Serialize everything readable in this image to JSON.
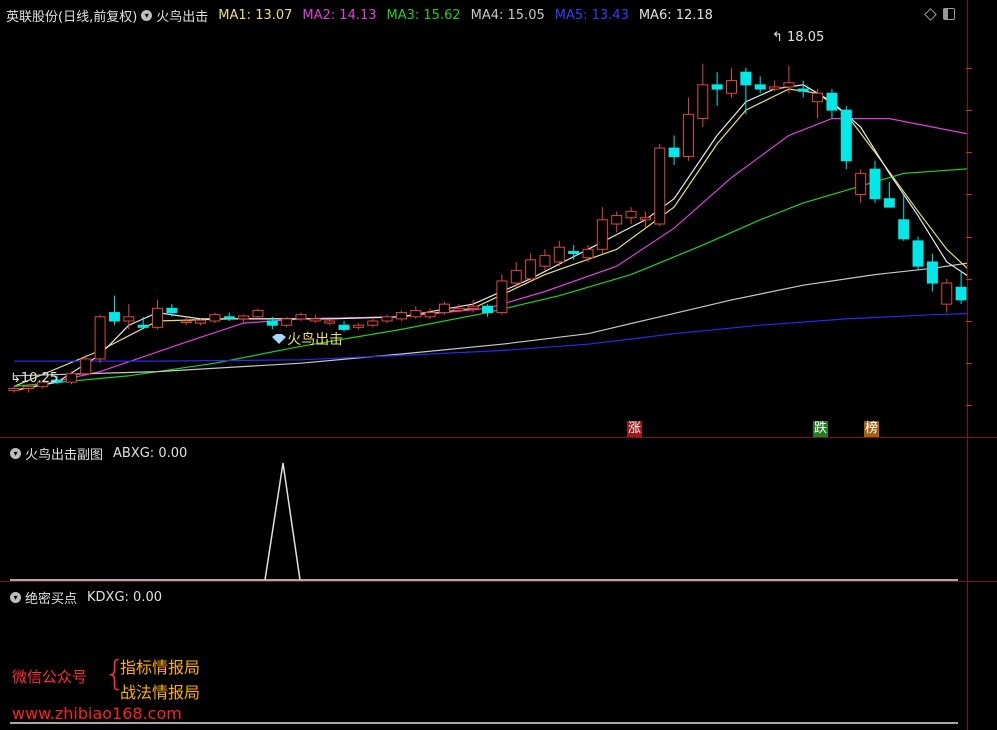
{
  "main": {
    "title": "英联股份(日线,前复权)",
    "indicator": "火鸟出击",
    "ma": [
      {
        "label": "MA1: 13.07",
        "color": "#e8e070"
      },
      {
        "label": "MA2: 14.13",
        "color": "#e040e0"
      },
      {
        "label": "MA3: 15.62",
        "color": "#20d020"
      },
      {
        "label": "MA4: 15.05",
        "color": "#c8c8c8"
      },
      {
        "label": "MA5: 13.43",
        "color": "#3a3aff"
      },
      {
        "label": "MA6: 12.18",
        "color": "#e0e0e0"
      }
    ],
    "high_label": "18.05",
    "low_label": "10.25",
    "signal_label": "火鸟出击",
    "markers": {
      "zhang": "涨",
      "die": "跌",
      "bang": "榜"
    }
  },
  "sub1": {
    "title": "火鸟出击副图",
    "value": "ABXG: 0.00"
  },
  "sub2": {
    "title": "绝密买点",
    "value": "KDXG: 0.00"
  },
  "watermark": {
    "wechat": "微信公众号",
    "line1": "指标情报局",
    "line2": "战法情报局",
    "url": "www.zhibiao168.com"
  },
  "colors": {
    "up": "#e0483a",
    "down": "#00e8e8",
    "grid": "#7a1818"
  },
  "chart_data": {
    "type": "candlestick",
    "candles": [
      [
        10.35,
        10.45,
        10.3,
        10.4
      ],
      [
        10.4,
        10.5,
        10.3,
        10.45
      ],
      [
        10.45,
        10.6,
        10.4,
        10.55
      ],
      [
        10.6,
        10.7,
        10.5,
        10.55
      ],
      [
        10.55,
        10.8,
        10.5,
        10.75
      ],
      [
        10.75,
        11.2,
        10.7,
        11.1
      ],
      [
        11.1,
        12.15,
        11.0,
        12.1
      ],
      [
        12.2,
        12.6,
        11.9,
        12.0
      ],
      [
        12.0,
        12.4,
        11.8,
        12.1
      ],
      [
        11.9,
        12.1,
        11.8,
        11.85
      ],
      [
        11.85,
        12.5,
        11.8,
        12.3
      ],
      [
        12.3,
        12.4,
        12.1,
        12.2
      ],
      [
        12.0,
        12.1,
        11.9,
        12.0
      ],
      [
        11.95,
        12.05,
        11.9,
        12.02
      ],
      [
        12.0,
        12.2,
        11.95,
        12.15
      ],
      [
        12.1,
        12.2,
        12.0,
        12.08
      ],
      [
        12.05,
        12.15,
        11.95,
        12.12
      ],
      [
        12.1,
        12.3,
        12.05,
        12.25
      ],
      [
        12.0,
        12.1,
        11.8,
        11.9
      ],
      [
        11.9,
        12.1,
        11.85,
        12.05
      ],
      [
        12.05,
        12.2,
        12.0,
        12.15
      ],
      [
        12.0,
        12.15,
        11.95,
        12.05
      ],
      [
        11.95,
        12.05,
        11.9,
        12.0
      ],
      [
        11.9,
        12.0,
        11.75,
        11.8
      ],
      [
        11.85,
        11.95,
        11.8,
        11.9
      ],
      [
        11.9,
        12.05,
        11.85,
        12.0
      ],
      [
        12.0,
        12.15,
        11.95,
        12.1
      ],
      [
        12.05,
        12.25,
        12.0,
        12.2
      ],
      [
        12.1,
        12.35,
        12.05,
        12.25
      ],
      [
        12.1,
        12.3,
        12.05,
        12.2
      ],
      [
        12.2,
        12.45,
        12.15,
        12.4
      ],
      [
        12.25,
        12.4,
        12.2,
        12.3
      ],
      [
        12.3,
        12.5,
        12.2,
        12.35
      ],
      [
        12.35,
        12.4,
        12.1,
        12.2
      ],
      [
        12.2,
        13.1,
        12.15,
        12.95
      ],
      [
        12.9,
        13.4,
        12.8,
        13.2
      ],
      [
        13.0,
        13.6,
        12.95,
        13.45
      ],
      [
        13.3,
        13.7,
        13.2,
        13.55
      ],
      [
        13.4,
        13.9,
        13.3,
        13.75
      ],
      [
        13.65,
        13.8,
        13.45,
        13.6
      ],
      [
        13.5,
        13.8,
        13.4,
        13.7
      ],
      [
        13.7,
        14.7,
        13.6,
        14.4
      ],
      [
        14.3,
        14.6,
        14.1,
        14.5
      ],
      [
        14.45,
        14.7,
        14.3,
        14.6
      ],
      [
        14.4,
        14.6,
        14.2,
        14.45
      ],
      [
        14.3,
        16.2,
        14.25,
        16.1
      ],
      [
        16.1,
        16.4,
        15.7,
        15.9
      ],
      [
        15.9,
        17.3,
        15.8,
        16.9
      ],
      [
        16.8,
        18.1,
        16.6,
        17.6
      ],
      [
        17.6,
        17.9,
        17.1,
        17.5
      ],
      [
        17.4,
        18.0,
        17.3,
        17.7
      ],
      [
        17.9,
        18.0,
        16.9,
        17.6
      ],
      [
        17.6,
        17.8,
        17.4,
        17.5
      ],
      [
        17.5,
        17.7,
        17.45,
        17.55
      ],
      [
        17.55,
        18.05,
        17.4,
        17.65
      ],
      [
        17.5,
        17.7,
        17.3,
        17.45
      ],
      [
        17.2,
        17.5,
        16.8,
        17.4
      ],
      [
        17.4,
        17.5,
        16.8,
        17.0
      ],
      [
        17.0,
        17.1,
        15.6,
        15.8
      ],
      [
        15.0,
        15.6,
        14.8,
        15.5
      ],
      [
        15.6,
        15.8,
        14.8,
        14.9
      ],
      [
        14.9,
        15.3,
        14.7,
        14.7
      ],
      [
        14.4,
        15.0,
        13.9,
        13.95
      ],
      [
        13.9,
        14.0,
        13.2,
        13.3
      ],
      [
        13.4,
        13.6,
        12.7,
        12.9
      ],
      [
        12.4,
        13.0,
        12.2,
        12.9
      ],
      [
        12.8,
        13.2,
        12.4,
        12.5
      ],
      [
        12.4,
        13.1,
        12.3,
        13.0
      ]
    ],
    "ma_lines": {
      "MA1": [
        [
          0,
          10.45
        ],
        [
          6,
          11.3
        ],
        [
          10,
          12.0
        ],
        [
          15,
          12.05
        ],
        [
          20,
          12.05
        ],
        [
          27,
          12.1
        ],
        [
          32,
          12.3
        ],
        [
          37,
          13.1
        ],
        [
          42,
          13.7
        ],
        [
          46,
          14.7
        ],
        [
          49,
          16.2
        ],
        [
          51,
          17.0
        ],
        [
          54,
          17.5
        ],
        [
          56,
          17.4
        ],
        [
          58,
          16.9
        ],
        [
          60,
          16.0
        ],
        [
          63,
          14.6
        ],
        [
          65,
          13.7
        ],
        [
          67,
          13.07
        ]
      ],
      "MA2": [
        [
          0,
          10.35
        ],
        [
          6,
          10.8
        ],
        [
          12,
          11.5
        ],
        [
          16,
          11.95
        ],
        [
          20,
          12.05
        ],
        [
          27,
          12.1
        ],
        [
          33,
          12.3
        ],
        [
          37,
          12.7
        ],
        [
          42,
          13.3
        ],
        [
          46,
          14.2
        ],
        [
          50,
          15.4
        ],
        [
          54,
          16.4
        ],
        [
          57,
          16.8
        ],
        [
          61,
          16.8
        ],
        [
          64,
          16.6
        ],
        [
          67,
          16.4
        ]
      ],
      "MA3": [
        [
          0,
          10.45
        ],
        [
          8,
          10.7
        ],
        [
          14,
          11.0
        ],
        [
          20,
          11.4
        ],
        [
          27,
          11.8
        ],
        [
          33,
          12.2
        ],
        [
          38,
          12.6
        ],
        [
          43,
          13.1
        ],
        [
          48,
          13.8
        ],
        [
          52,
          14.4
        ],
        [
          55,
          14.8
        ],
        [
          58,
          15.1
        ],
        [
          62,
          15.5
        ],
        [
          64,
          15.55
        ],
        [
          67,
          15.62
        ]
      ],
      "MA4": [
        [
          0,
          10.7
        ],
        [
          10,
          10.8
        ],
        [
          20,
          11.0
        ],
        [
          28,
          11.25
        ],
        [
          34,
          11.45
        ],
        [
          40,
          11.7
        ],
        [
          45,
          12.1
        ],
        [
          50,
          12.5
        ],
        [
          55,
          12.85
        ],
        [
          60,
          13.1
        ],
        [
          64,
          13.25
        ],
        [
          67,
          13.4
        ]
      ],
      "MA5": [
        [
          0,
          11.05
        ],
        [
          10,
          11.05
        ],
        [
          20,
          11.08
        ],
        [
          28,
          11.2
        ],
        [
          34,
          11.3
        ],
        [
          40,
          11.45
        ],
        [
          46,
          11.7
        ],
        [
          52,
          11.9
        ],
        [
          58,
          12.05
        ],
        [
          64,
          12.15
        ],
        [
          67,
          12.18
        ]
      ],
      "MA6": [
        [
          0,
          10.35
        ],
        [
          3,
          10.55
        ],
        [
          6,
          11.2
        ],
        [
          8,
          11.9
        ],
        [
          10,
          12.2
        ],
        [
          13,
          12.05
        ],
        [
          17,
          12.05
        ],
        [
          22,
          12.05
        ],
        [
          27,
          12.1
        ],
        [
          32,
          12.4
        ],
        [
          36,
          13.0
        ],
        [
          40,
          13.7
        ],
        [
          44,
          14.4
        ],
        [
          46,
          14.9
        ],
        [
          49,
          16.4
        ],
        [
          51,
          17.2
        ],
        [
          53,
          17.5
        ],
        [
          55,
          17.6
        ],
        [
          57,
          17.2
        ],
        [
          59,
          16.6
        ],
        [
          61,
          15.5
        ],
        [
          63,
          14.5
        ],
        [
          65,
          13.4
        ],
        [
          67,
          12.95
        ]
      ]
    },
    "ylim": [
      9.7,
      18.9
    ]
  }
}
